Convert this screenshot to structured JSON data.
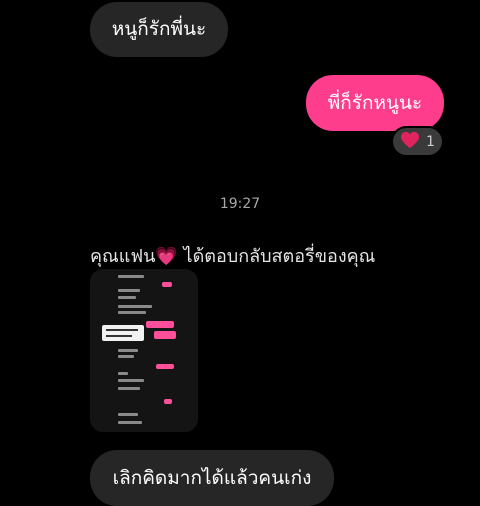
{
  "messages": {
    "incoming_1": "หนูก็รักพี่นะ",
    "outgoing_1": "พี่ก็รักหนูนะ",
    "incoming_2": "เลิกคิดมากได้แล้วคนเก่ง"
  },
  "reaction": {
    "icon": "heart-icon",
    "count": "1",
    "color": "#e0245e"
  },
  "timestamp": "19:27",
  "story_reply": {
    "label": "คุณแฟน💗 ได้ตอบกลับสตอรี่ของคุณ",
    "thumbnail_icon": "story-screenshot"
  },
  "colors": {
    "outgoing_bubble": "#ff3d8d",
    "incoming_bubble": "#262626",
    "background": "#000000"
  }
}
